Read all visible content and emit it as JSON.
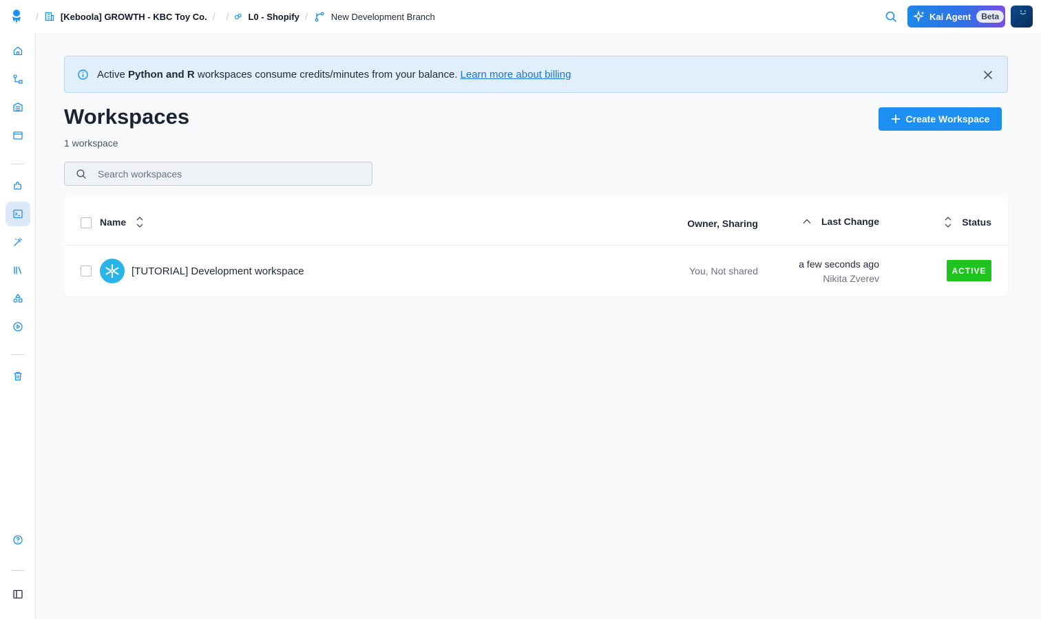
{
  "breadcrumbs": {
    "organization": "[Keboola] GROWTH - KBC Toy Co.",
    "project": "L0 - Shopify",
    "branch": "New Development Branch"
  },
  "header": {
    "kai_label": "Kai Agent",
    "kai_badge": "Beta"
  },
  "sidebar": {
    "items": [
      "home-icon",
      "flows-icon",
      "storage-icon",
      "jobs-icon",
      "components-icon",
      "workspaces-icon",
      "transformations-icon",
      "library-icon",
      "templates-icon",
      "runs-icon",
      "trash-icon",
      "help-icon",
      "collapse-sidebar-icon"
    ],
    "active": "workspaces-icon"
  },
  "banner": {
    "prefix": "Active ",
    "highlight": "Python and R",
    "suffix": " workspaces consume credits/minutes from your balance.",
    "link": "Learn more about billing"
  },
  "page": {
    "title": "Workspaces",
    "count": "1 workspace",
    "create_label": "Create Workspace"
  },
  "search": {
    "placeholder": "Search workspaces"
  },
  "table": {
    "columns": {
      "name": "Name",
      "owner": "Owner, Sharing",
      "last_change": "Last Change",
      "status": "Status"
    },
    "rows": [
      {
        "name": "[TUTORIAL] Development workspace",
        "owner": "You, Not shared",
        "last_change": "a few seconds ago",
        "changed_by": "Nikita Zverev",
        "status": "ACTIVE"
      }
    ]
  },
  "colors": {
    "accent": "#1d8ff2",
    "status_active": "#1ec31e",
    "banner_bg": "#e1effd",
    "snowflake": "#29b5e8"
  }
}
